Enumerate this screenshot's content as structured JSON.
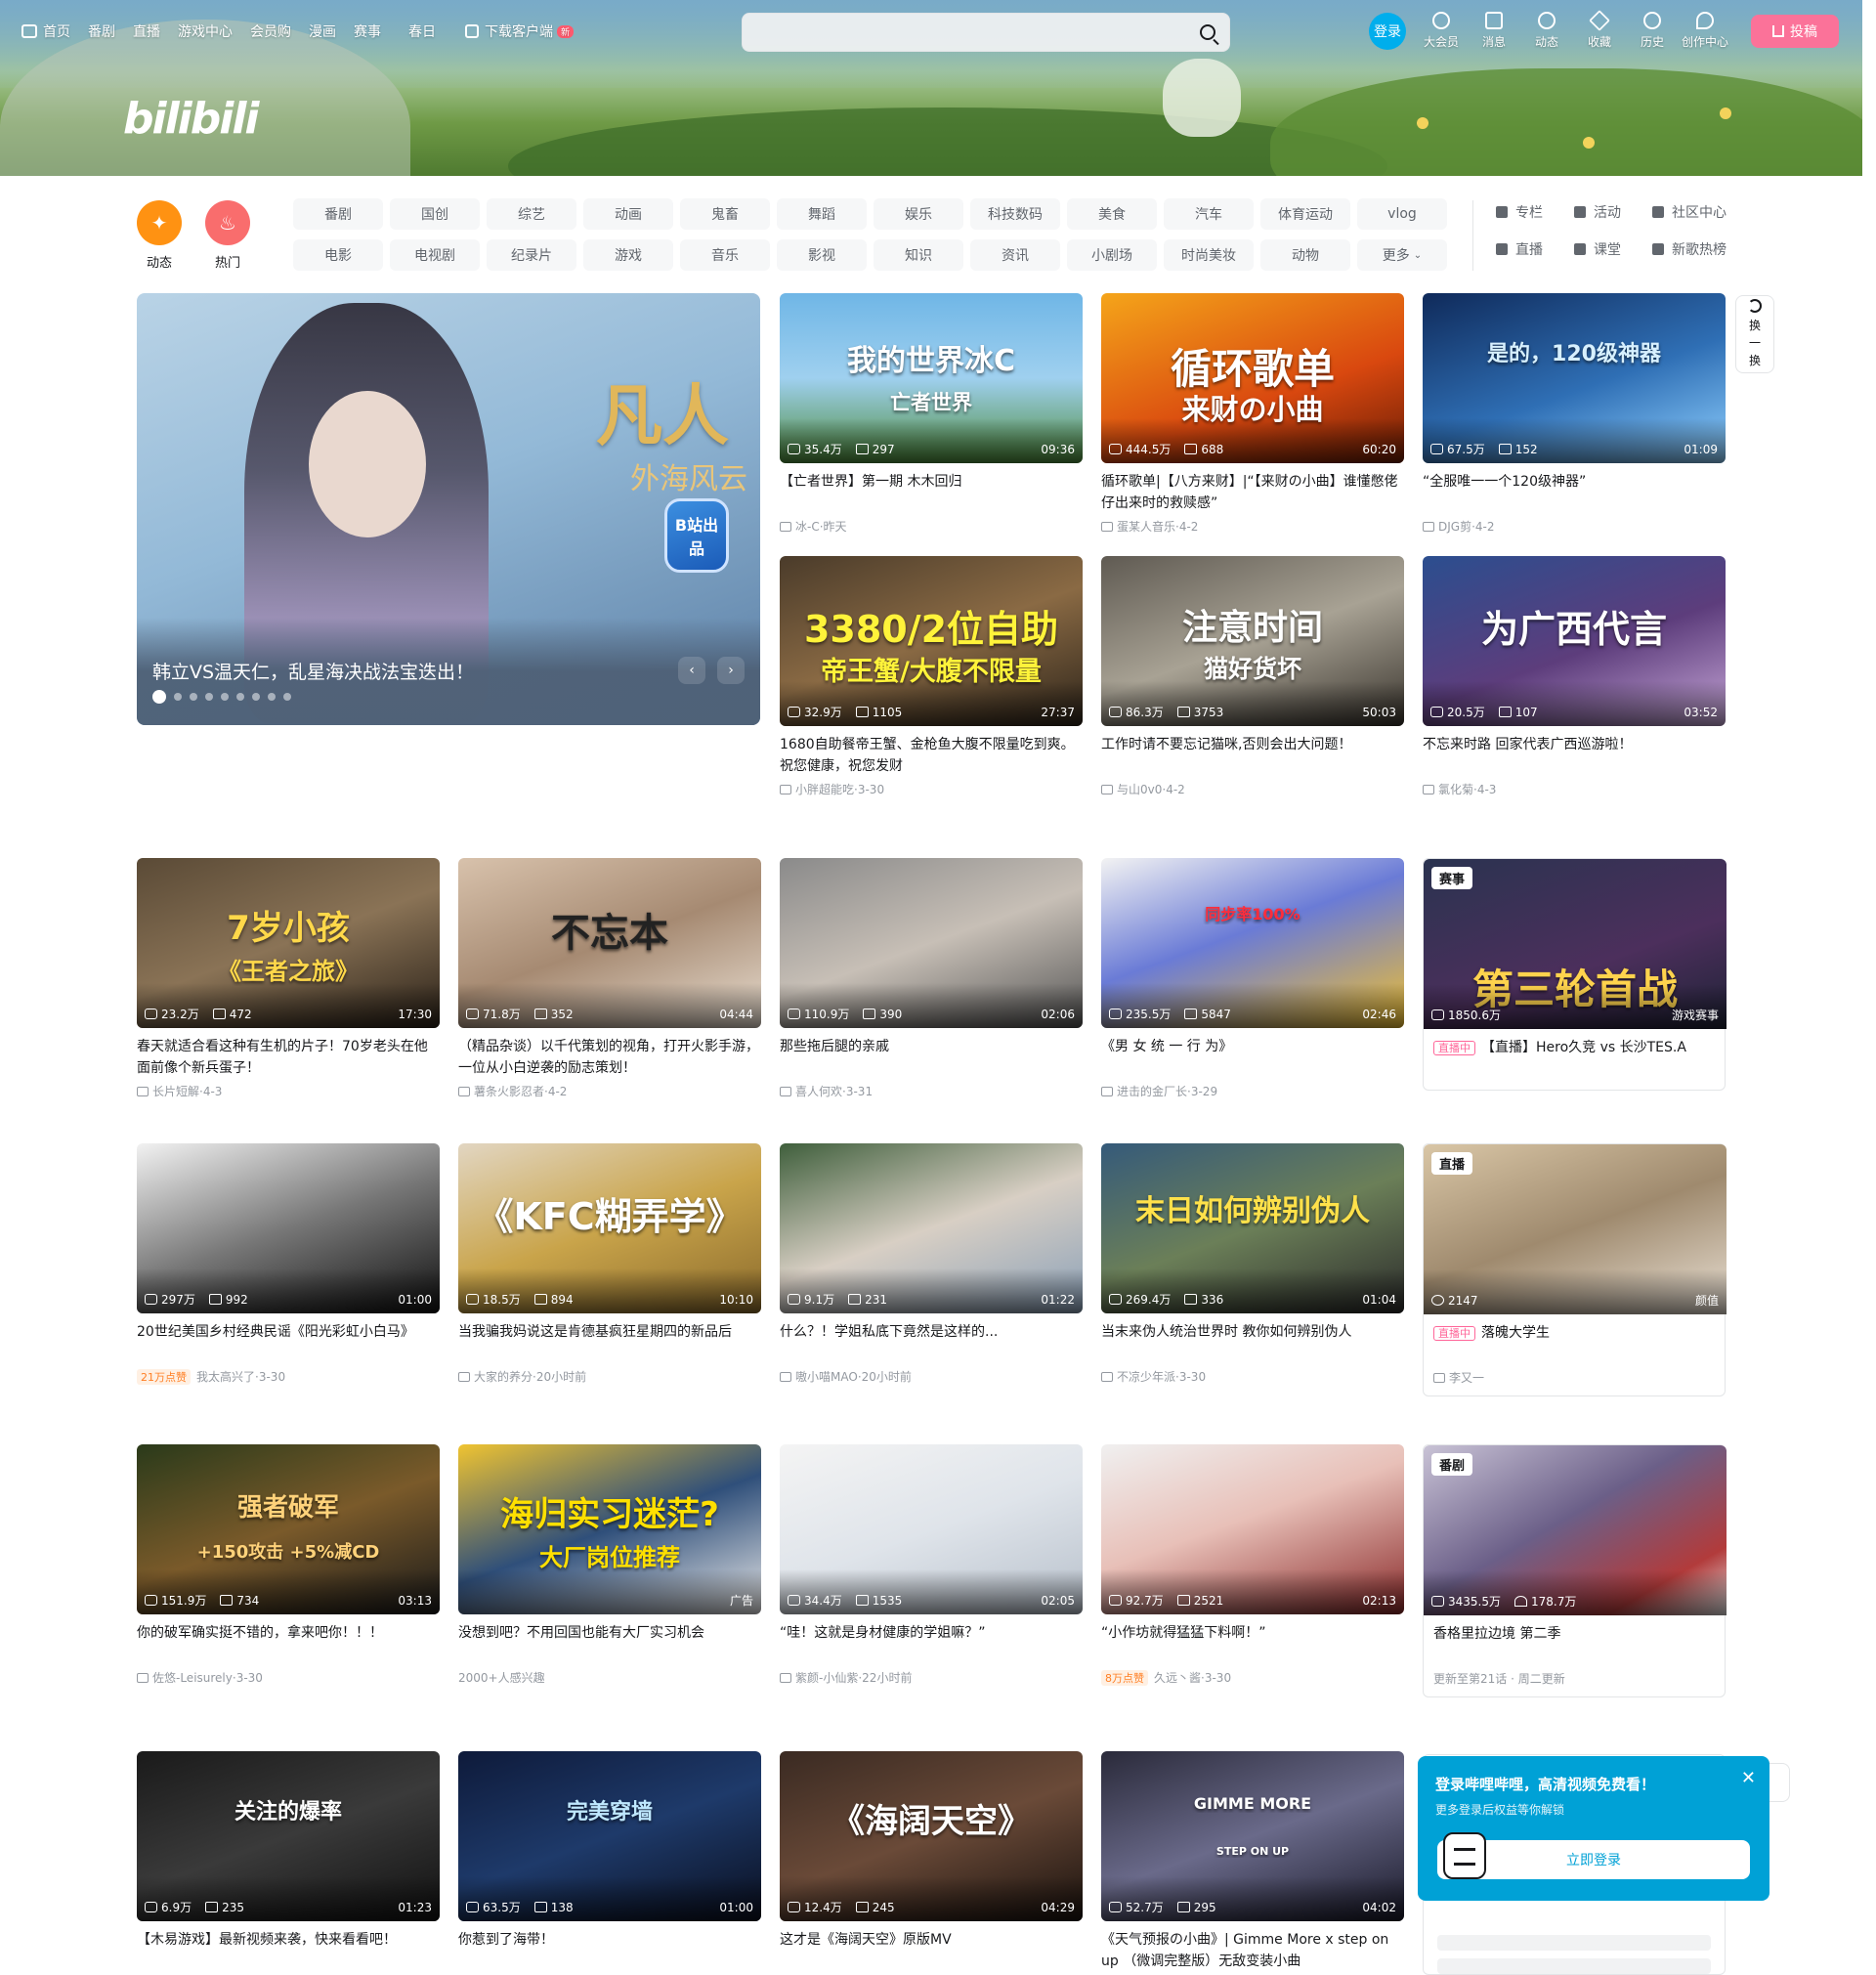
{
  "header": {
    "nav": [
      "首页",
      "番剧",
      "直播",
      "游戏中心",
      "会员购",
      "漫画",
      "赛事",
      "春日",
      "下载客户端"
    ],
    "new_badge": "新",
    "search": {
      "placeholder": "",
      "value": ""
    },
    "login_label": "登录",
    "right_icons": [
      {
        "label": "大会员",
        "icon": "vip-icon"
      },
      {
        "label": "消息",
        "icon": "message-icon"
      },
      {
        "label": "动态",
        "icon": "dynamic-icon"
      },
      {
        "label": "收藏",
        "icon": "favorite-icon"
      },
      {
        "label": "历史",
        "icon": "history-icon"
      },
      {
        "label": "创作中心",
        "icon": "creator-icon"
      }
    ],
    "upload_label": "投稿",
    "logo": "bilibili",
    "accent": "#fb7299",
    "blue": "#00aeec"
  },
  "channel_bar": {
    "dynamic_label": "动态",
    "hot_label": "热门",
    "channels": [
      "番剧",
      "国创",
      "综艺",
      "动画",
      "鬼畜",
      "舞蹈",
      "娱乐",
      "科技数码",
      "美食",
      "汽车",
      "体育运动",
      "vlog",
      "电影",
      "电视剧",
      "纪录片",
      "游戏",
      "音乐",
      "影视",
      "知识",
      "资讯",
      "小剧场",
      "时尚美妆",
      "动物",
      "更多"
    ],
    "quick_links": [
      "专栏",
      "活动",
      "社区中心",
      "直播",
      "课堂",
      "新歌热榜"
    ]
  },
  "carousel": {
    "caption": "韩立VS温天仁，乱星海决战法宝迭出！",
    "art_title": "凡人",
    "art_subtitle": "外海风云",
    "badge": "B站出品",
    "dots": 9,
    "active_dot": 0
  },
  "refresh_label": [
    "换",
    "一",
    "换"
  ],
  "videos": [
    {
      "title": "【亡者世界】第一期 木木回归",
      "views": "35.4万",
      "danmaku": "297",
      "duration": "09:36",
      "up": "冰-C",
      "date": "昨天",
      "art": "我的世界冰C",
      "art2": "亡者世界"
    },
    {
      "title": "循环歌单|【八方来财】|“【来财の小曲】谁懂憋佬仔出来时的救赎感”",
      "views": "444.5万",
      "danmaku": "688",
      "duration": "60:20",
      "up": "蛋某人音乐",
      "date": "4-2",
      "art": "循环歌单",
      "art2": "来财の小曲"
    },
    {
      "title": "“全服唯一一个120级神器”",
      "views": "67.5万",
      "danmaku": "152",
      "duration": "01:09",
      "up": "DJG剪",
      "date": "4-2",
      "art": "是的，120级神器",
      "art2": ""
    },
    {
      "title": "1680自助餐帝王蟹、金枪鱼大腹不限量吃到爽。祝您健康，祝您发财",
      "views": "32.9万",
      "danmaku": "1105",
      "duration": "27:37",
      "up": "小胖超能吃",
      "date": "3-30",
      "art": "3380/2位自助",
      "art2": "帝王蟹/大腹不限量"
    },
    {
      "title": "工作时请不要忘记猫咪,否则会出大问题！",
      "views": "86.3万",
      "danmaku": "3753",
      "duration": "50:03",
      "up": "与山0v0",
      "date": "4-2",
      "art": "注意时间",
      "art2": "猫好货坏"
    },
    {
      "title": "不忘来时路 回家代表广西巡游啦！",
      "views": "20.5万",
      "danmaku": "107",
      "duration": "03:52",
      "up": "氯化菊",
      "date": "4-3",
      "art": "为广西代言",
      "art2": ""
    },
    {
      "title": "春天就适合看这种有生机的片子！70岁老头在他面前像个新兵蛋子！",
      "views": "23.2万",
      "danmaku": "472",
      "duration": "17:30",
      "up": "长片短解",
      "date": "4-3",
      "art": "7岁小孩",
      "art2": "《王者之旅》"
    },
    {
      "title": "（精品杂谈）以千代策划的视角，打开火影手游，一位从小白逆袭的励志策划！",
      "views": "71.8万",
      "danmaku": "352",
      "duration": "04:44",
      "up": "薯条火影忍者",
      "date": "4-2",
      "art": "不忘本",
      "art2": ""
    },
    {
      "title": "那些拖后腿的亲戚",
      "views": "110.9万",
      "danmaku": "390",
      "duration": "02:06",
      "up": "喜人何欢",
      "date": "3-31",
      "art": "",
      "art2": ""
    },
    {
      "title": "《男 女 统 一 行 为》",
      "views": "235.5万",
      "danmaku": "5847",
      "duration": "02:46",
      "up": "进击的金厂长",
      "date": "3-29",
      "art": "同步率100%",
      "art2": ""
    },
    {
      "title": "20世纪美国乡村经典民谣《阳光彩虹小白马》",
      "views": "297万",
      "danmaku": "992",
      "duration": "01:00",
      "up": "我太高兴了",
      "date": "3-30",
      "hot": "21万点赞",
      "art": "",
      "art2": ""
    },
    {
      "title": "当我骗我妈说这是肯德基疯狂星期四的新品后",
      "views": "18.5万",
      "danmaku": "894",
      "duration": "10:10",
      "up": "大家的养分",
      "date": "20小时前",
      "art": "《KFC糊弄学》",
      "art2": ""
    },
    {
      "title": "什么？！学姐私底下竟然是这样的...",
      "views": "9.1万",
      "danmaku": "231",
      "duration": "01:22",
      "up": "嗷小喵MAO",
      "date": "20小时前",
      "art": "",
      "art2": ""
    },
    {
      "title": "当末来伪人统治世界时 教你如何辨别伪人",
      "views": "269.4万",
      "danmaku": "336",
      "duration": "01:04",
      "up": "不凉少年派",
      "date": "3-30",
      "art": "末日如何辨别伪人",
      "art2": ""
    },
    {
      "title": "你的破军确实挺不错的，拿来吧你！！！",
      "views": "151.9万",
      "danmaku": "734",
      "duration": "03:13",
      "up": "佐悠-Leisurely",
      "date": "3-30",
      "art": "强者破军",
      "art2": "+150攻击 +5%减CD"
    },
    {
      "title": "没想到吧？不用回国也能有大厂实习机会",
      "views": "",
      "danmaku": "",
      "duration": "广告",
      "up": "",
      "date": "",
      "meta": "2000+人感兴趣",
      "art": "海归实习迷茫?",
      "art2": "大厂岗位推荐"
    },
    {
      "title": "“哇！这就是身材健康的学姐嘛？”",
      "views": "34.4万",
      "danmaku": "1535",
      "duration": "02:05",
      "up": "紫颜-小仙紫",
      "date": "22小时前",
      "art": "",
      "art2": ""
    },
    {
      "title": "“小作坊就得猛猛下料啊！”",
      "views": "92.7万",
      "danmaku": "2521",
      "duration": "02:13",
      "up": "久远丶酱",
      "date": "3-30",
      "hot": "8万点赞",
      "art": "",
      "art2": ""
    },
    {
      "title": "【木易游戏】最新视频来袭，快来看看吧！",
      "views": "6.9万",
      "danmaku": "235",
      "duration": "01:23",
      "up": "",
      "date": "",
      "art": "关注的爆率",
      "art2": ""
    },
    {
      "title": "你惹到了海带！",
      "views": "63.5万",
      "danmaku": "138",
      "duration": "01:00",
      "up": "",
      "date": "",
      "art": "完美穿墙",
      "art2": ""
    },
    {
      "title": "这才是《海阔天空》原版MV",
      "views": "12.4万",
      "danmaku": "245",
      "duration": "04:29",
      "up": "",
      "date": "",
      "art": "《海阔天空》",
      "art2": ""
    },
    {
      "title": "《天气预报の小曲》| Gimme More x step on up （微调完整版）无敌变装小曲",
      "views": "52.7万",
      "danmaku": "295",
      "duration": "04:02",
      "up": "",
      "date": "",
      "art": "GIMME MORE",
      "art2": "STEP ON UP"
    }
  ],
  "specials": [
    {
      "tag": "赛事",
      "title": "【直播】Hero久竞 vs 长沙TES.A",
      "live_tag": "直播中",
      "views": "1850.6万",
      "right": "游戏赛事",
      "art": "第三轮首战"
    },
    {
      "tag": "直播",
      "title": "落魄大学生",
      "live_tag": "直播中",
      "views": "2147",
      "right": "颜值",
      "up": "李又一"
    },
    {
      "tag": "番剧",
      "title": "香格里拉边境 第二季",
      "views": "3435.5万",
      "likes": "178.7万",
      "meta": "更新至第21话 · 周二更新"
    }
  ],
  "popup": {
    "title": "登录哔哩哔哩，高清视频免费看！",
    "subtitle": "更多登录后权益等你解锁",
    "button": "立即登录",
    "close": "✕"
  }
}
